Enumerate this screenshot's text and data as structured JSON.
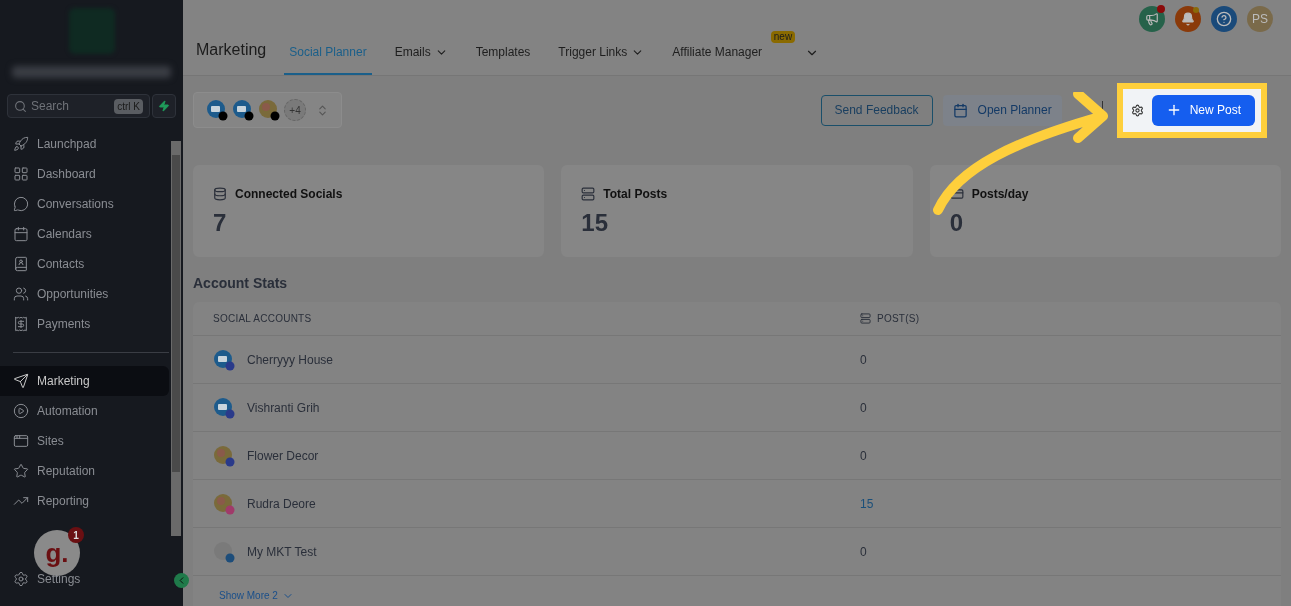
{
  "sidebar": {
    "search": {
      "placeholder": "Search",
      "shortcut": "ctrl K"
    },
    "items": [
      {
        "label": "Launchpad",
        "selected": false
      },
      {
        "label": "Dashboard",
        "selected": false
      },
      {
        "label": "Conversations",
        "selected": false
      },
      {
        "label": "Calendars",
        "selected": false
      },
      {
        "label": "Contacts",
        "selected": false
      },
      {
        "label": "Opportunities",
        "selected": false
      },
      {
        "label": "Payments",
        "selected": false
      }
    ],
    "items_2": [
      {
        "label": "Marketing",
        "selected": true
      },
      {
        "label": "Automation",
        "selected": false
      },
      {
        "label": "Sites",
        "selected": false
      },
      {
        "label": "Reputation",
        "selected": false
      },
      {
        "label": "Reporting",
        "selected": false
      }
    ],
    "settings": "Settings",
    "chat_widget": {
      "logo": "g.",
      "badge": "1"
    }
  },
  "header": {
    "title": "Marketing",
    "tabs": [
      {
        "label": "Social Planner",
        "selected": true,
        "dropdown": false
      },
      {
        "label": "Emails",
        "selected": false,
        "dropdown": true
      },
      {
        "label": "Templates",
        "selected": false,
        "dropdown": false
      },
      {
        "label": "Trigger Links",
        "selected": false,
        "dropdown": true
      },
      {
        "label": "Affiliate Manager",
        "selected": false,
        "dropdown": false,
        "badge": "new"
      }
    ],
    "avatar_initials": "PS"
  },
  "toolbar": {
    "accounts_more": "+4",
    "send_feedback": "Send Feedback",
    "open_planner": "Open Planner",
    "new_post": "New Post"
  },
  "stats": [
    {
      "label": "Connected Socials",
      "value": "7"
    },
    {
      "label": "Total Posts",
      "value": "15"
    },
    {
      "label": "Posts/day",
      "value": "0"
    }
  ],
  "account_stats": {
    "title": "Account Stats",
    "columns": [
      "SOCIAL ACCOUNTS",
      "POST(S)"
    ],
    "rows": [
      {
        "name": "Cherryyy House",
        "posts": "0"
      },
      {
        "name": "Vishranti Grih",
        "posts": "0"
      },
      {
        "name": "Flower Decor",
        "posts": "0"
      },
      {
        "name": "Rudra Deore",
        "posts": "15"
      },
      {
        "name": "My MKT Test",
        "posts": "0"
      }
    ],
    "show_more": "Show More 2"
  }
}
